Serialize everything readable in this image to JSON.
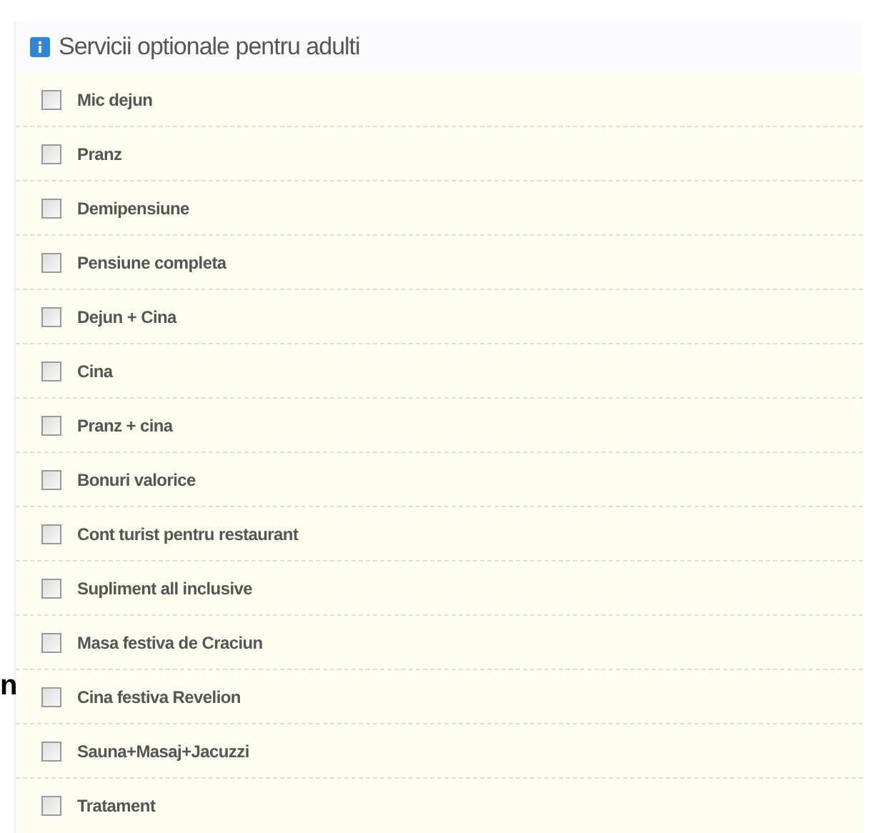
{
  "margin_text": "n",
  "panel": {
    "title": "Servicii optionale pentru adulti",
    "options": [
      {
        "label": "Mic dejun",
        "checked": false
      },
      {
        "label": "Pranz",
        "checked": false
      },
      {
        "label": "Demipensiune",
        "checked": false
      },
      {
        "label": "Pensiune completa",
        "checked": false
      },
      {
        "label": "Dejun + Cina",
        "checked": false
      },
      {
        "label": "Cina",
        "checked": false
      },
      {
        "label": "Pranz + cina",
        "checked": false
      },
      {
        "label": "Bonuri valorice",
        "checked": false
      },
      {
        "label": "Cont turist pentru restaurant",
        "checked": false
      },
      {
        "label": "Supliment all inclusive",
        "checked": false
      },
      {
        "label": "Masa festiva de Craciun",
        "checked": false
      },
      {
        "label": "Cina festiva Revelion",
        "checked": false
      },
      {
        "label": "Sauna+Masaj+Jacuzzi",
        "checked": false
      },
      {
        "label": "Tratament",
        "checked": false
      }
    ]
  }
}
